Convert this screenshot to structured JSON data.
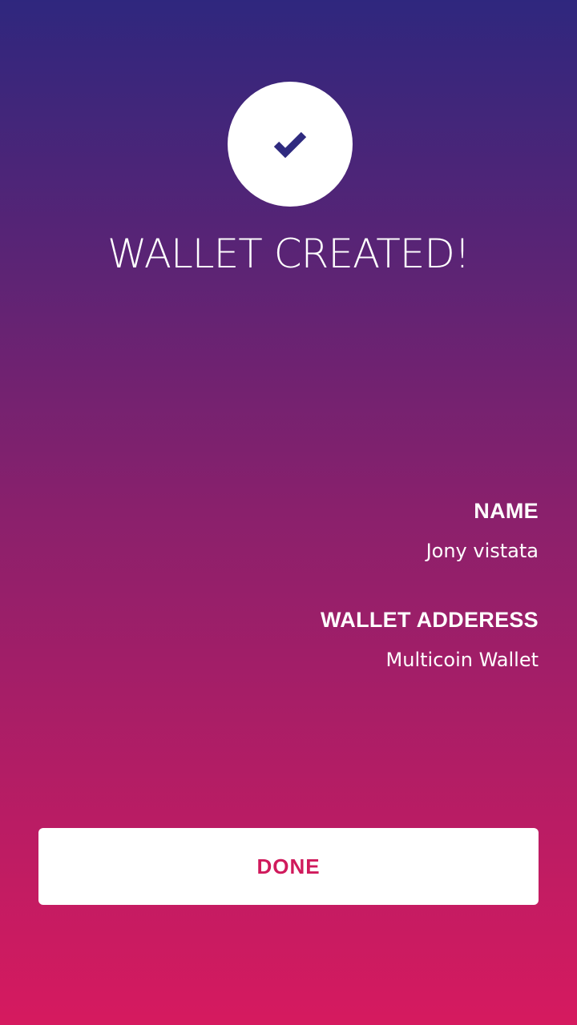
{
  "header": {
    "icon": "checkmark-icon",
    "title": "WALLET CREATED!"
  },
  "details": {
    "name_label": "NAME",
    "name_value": "Jony vistata",
    "address_label": "WALLET ADDERESS",
    "address_value": "Multicoin Wallet"
  },
  "actions": {
    "done_label": "DONE"
  },
  "colors": {
    "gradient_top": "#2f277e",
    "gradient_bottom": "#d61a5f",
    "check_color": "#2f2a7f",
    "button_text": "#d01a5c"
  }
}
